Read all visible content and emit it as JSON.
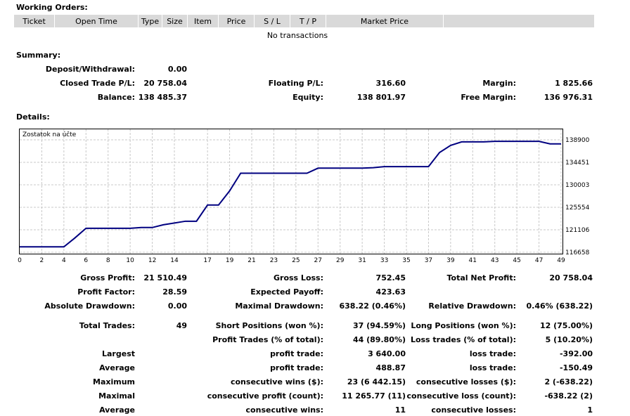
{
  "working_orders": {
    "title": "Working Orders:",
    "columns": [
      "Ticket",
      "Open Time",
      "Type",
      "Size",
      "Item",
      "Price",
      "S / L",
      "T / P",
      "Market Price",
      ""
    ],
    "empty_text": "No transactions"
  },
  "summary": {
    "title": "Summary:",
    "deposit_label": "Deposit/Withdrawal:",
    "deposit": "0.00",
    "closed_label": "Closed Trade P/L:",
    "closed": "20 758.04",
    "balance_label": "Balance:",
    "balance": "138 485.37",
    "floating_label": "Floating P/L:",
    "floating": "316.60",
    "equity_label": "Equity:",
    "equity": "138 801.97",
    "margin_label": "Margin:",
    "margin": "1 825.66",
    "free_margin_label": "Free Margin:",
    "free_margin": "136 976.31"
  },
  "details": {
    "title": "Details:"
  },
  "chart_data": {
    "type": "line",
    "title": "Zostatok na účte",
    "xlim": [
      0,
      49
    ],
    "ylim": [
      116658,
      138900
    ],
    "x_ticks": [
      0,
      2,
      4,
      6,
      8,
      10,
      12,
      14,
      17,
      19,
      21,
      23,
      25,
      27,
      29,
      31,
      33,
      35,
      37,
      39,
      41,
      43,
      45,
      47,
      49
    ],
    "y_ticks": [
      116658,
      121106,
      125554,
      130003,
      134451,
      138900
    ],
    "line_color": "#000080",
    "grid": true,
    "series": [
      {
        "name": "",
        "x": [
          0,
          1,
          2,
          3,
          4,
          5,
          6,
          7,
          8,
          9,
          10,
          11,
          12,
          13,
          14,
          15,
          16,
          17,
          18,
          19,
          20,
          21,
          22,
          23,
          24,
          25,
          26,
          27,
          28,
          29,
          30,
          31,
          32,
          33,
          34,
          35,
          36,
          37,
          38,
          39,
          40,
          41,
          42,
          43,
          44,
          45,
          46,
          47,
          48,
          49
        ],
        "y": [
          117727,
          117727,
          117727,
          117727,
          117727,
          119500,
          121400,
          121400,
          121400,
          121400,
          121400,
          121550,
          121550,
          122100,
          122450,
          122800,
          122800,
          126000,
          126000,
          128800,
          132300,
          132300,
          132300,
          132300,
          132300,
          132300,
          132300,
          133300,
          133300,
          133300,
          133300,
          133300,
          133400,
          133600,
          133600,
          133600,
          133600,
          133600,
          136400,
          137800,
          138500,
          138500,
          138500,
          138600,
          138600,
          138600,
          138600,
          138600,
          138100,
          138100
        ]
      }
    ]
  },
  "stats": {
    "gross_profit_label": "Gross Profit:",
    "gross_profit": "21 510.49",
    "gross_loss_label": "Gross Loss:",
    "gross_loss": "752.45",
    "total_net_label": "Total Net Profit:",
    "total_net": "20 758.04",
    "profit_factor_label": "Profit Factor:",
    "profit_factor": "28.59",
    "expected_payoff_label": "Expected Payoff:",
    "expected_payoff": "423.63",
    "abs_dd_label": "Absolute Drawdown:",
    "abs_dd": "0.00",
    "max_dd_label": "Maximal Drawdown:",
    "max_dd": "638.22 (0.46%)",
    "rel_dd_label": "Relative Drawdown:",
    "rel_dd": "0.46% (638.22)",
    "total_trades_label": "Total Trades:",
    "total_trades": "49",
    "short_label": "Short Positions (won %):",
    "short": "37 (94.59%)",
    "long_label": "Long Positions (won %):",
    "long": "12 (75.00%)",
    "profit_trades_label": "Profit Trades (% of total):",
    "profit_trades": "44 (89.80%)",
    "loss_trades_label": "Loss trades (% of total):",
    "loss_trades": "5 (10.20%)",
    "largest_label": "Largest",
    "largest_profit_label": "profit trade:",
    "largest_profit": "3 640.00",
    "largest_loss_label": "loss trade:",
    "largest_loss": "-392.00",
    "average_label": "Average",
    "average_profit_label": "profit trade:",
    "average_profit": "488.87",
    "average_loss_label": "loss trade:",
    "average_loss": "-150.49",
    "maximum_label": "Maximum",
    "max_cons_wins_label": "consecutive wins ($):",
    "max_cons_wins": "23 (6 442.15)",
    "max_cons_losses_label": "consecutive losses ($):",
    "max_cons_losses": "2 (-638.22)",
    "maximal_label": "Maximal",
    "maximal_profit_label": "consecutive profit (count):",
    "maximal_profit": "11 265.77 (11)",
    "maximal_loss_label": "consecutive loss (count):",
    "maximal_loss": "-638.22 (2)",
    "average2_label": "Average",
    "avg_cons_wins_label": "consecutive wins:",
    "avg_cons_wins": "11",
    "avg_cons_losses_label": "consecutive losses:",
    "avg_cons_losses": "1"
  }
}
